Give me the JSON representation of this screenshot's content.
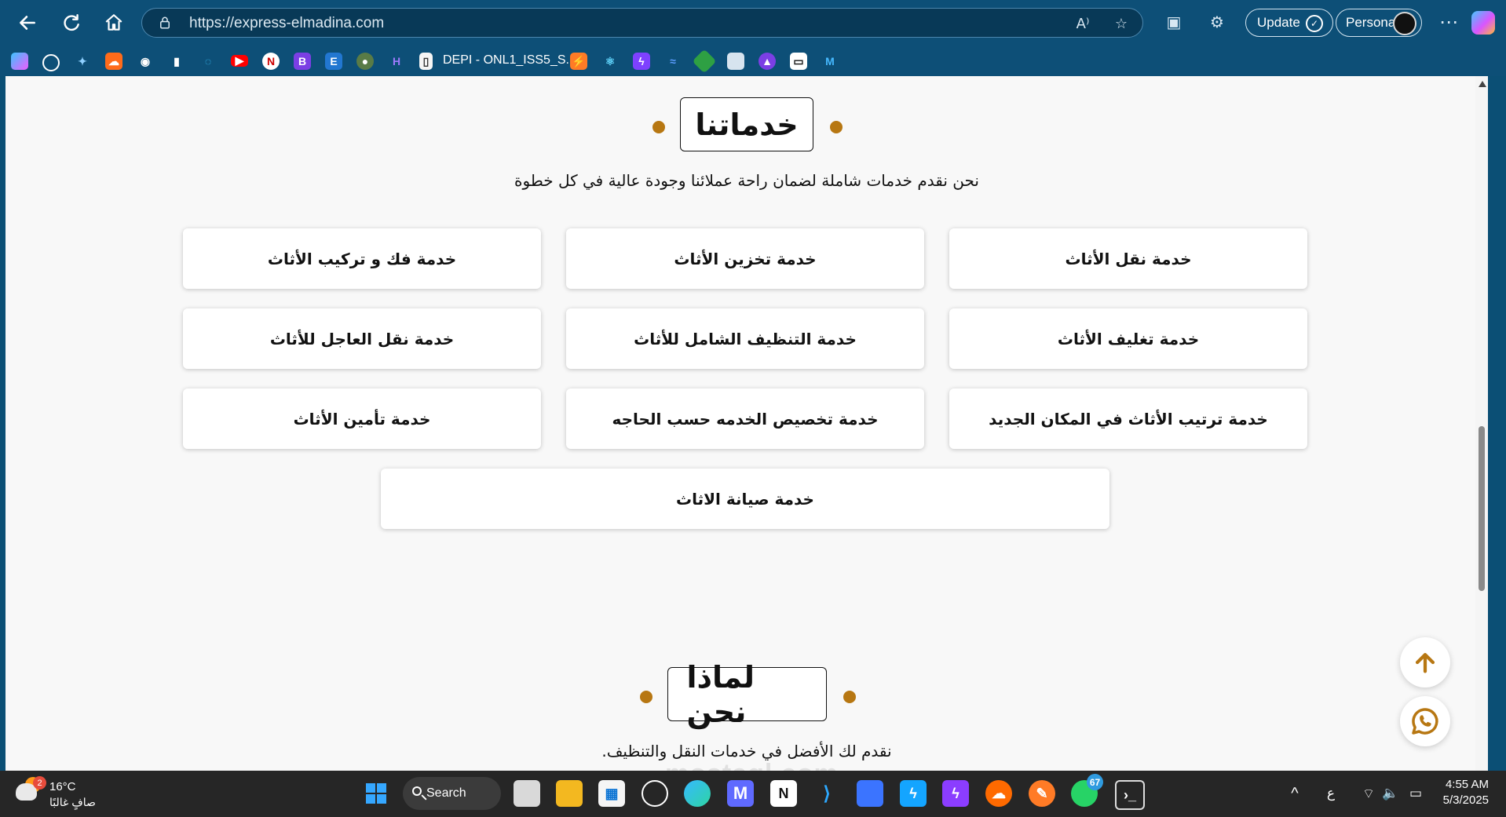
{
  "browser": {
    "url": "https://express-elmadina.com",
    "update_label": "Update",
    "profile_label": "Personal",
    "bookmark_text": "DEPI - ONL1_ISS5_S..."
  },
  "page": {
    "services": {
      "title": "خدماتنا",
      "subtitle": "نحن نقدم خدمات شاملة لضمان راحة عملائنا وجودة عالية في كل خطوة",
      "items": [
        "خدمة نقل الأثاث",
        "خدمة تخزين الأثاث",
        "خدمة فك و تركيب الأثاث",
        "خدمة تغليف الأثاث",
        "خدمة التنظيف الشامل للأثاث",
        "خدمة نقل العاجل للأثاث",
        "خدمة ترتيب الأثاث في المكان الجديد",
        "خدمة تخصيص الخدمه حسب الحاجه",
        "خدمة تأمين الأثاث",
        "خدمة صيانة الاثاث"
      ]
    },
    "why_us": {
      "title": "لماذا نحن",
      "subtitle": "نقدم لك الأفضل في خدمات النقل والتنظيف."
    },
    "watermark": "mostaql.com"
  },
  "taskbar": {
    "weather_temp": "16°C",
    "weather_status": "صافٍ غالبًا",
    "weather_badge": "2",
    "search_label": "Search",
    "language": "ع",
    "time": "4:55 AM",
    "date": "5/3/2025",
    "whatsapp_badge": "67"
  },
  "colors": {
    "browser_bg": "#0d4f77",
    "page_bg": "#f8f8f8",
    "accent": "#b77712",
    "taskbar_bg": "#262626"
  }
}
